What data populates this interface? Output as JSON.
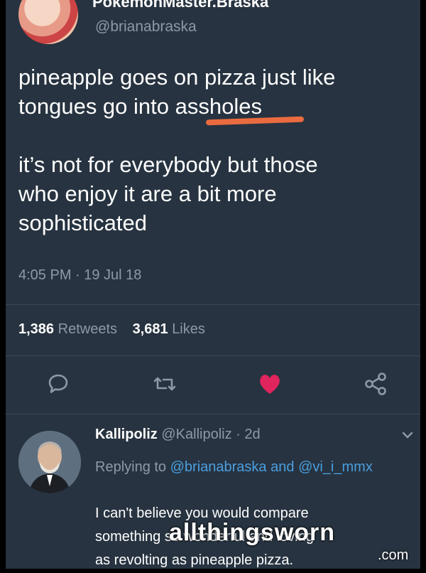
{
  "tweet": {
    "display_name": "PokemonMaster.Braska",
    "handle": "@brianabraska",
    "text": "pineapple goes on pizza just like\ntongues go into assholes\n\nit’s not for everybody but those\nwho enjoy it are a bit more\nsophisticated",
    "timestamp": "4:05 PM · 19 Jul 18",
    "retweets_count": "1,386",
    "retweets_label": "Retweets",
    "likes_count": "3,681",
    "likes_label": "Likes"
  },
  "actions": {
    "icons": [
      "reply-icon",
      "retweet-icon",
      "heart-icon",
      "share-icon"
    ],
    "like_color": "#e0245e"
  },
  "reply": {
    "name": "Kallipoliz",
    "meta": "@Kallipoliz · 2d",
    "replying_prefix": "Replying to",
    "mention_1": "@brianabraska",
    "and": "and",
    "mention_2": "@vi_i_mmx",
    "text": "I can't believe you would compare\nsomething so wonderful and loving\nas revolting as pineapple pizza."
  },
  "watermark": {
    "text": "allthingsworn",
    "suffix": ".com"
  },
  "colors": {
    "background": "#273340",
    "muted": "#8d9aa6",
    "link": "#4a9fe0",
    "strike": "#ea6b3f"
  }
}
